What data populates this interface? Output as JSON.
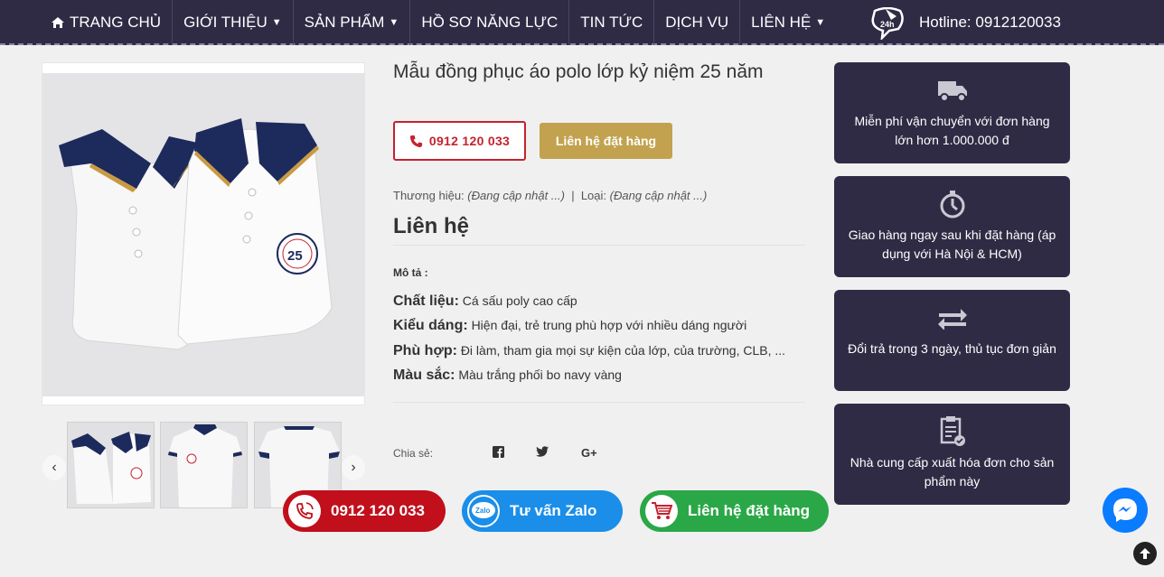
{
  "nav": {
    "items": [
      {
        "label": "TRANG CHỦ",
        "icon": "home-icon"
      },
      {
        "label": "GIỚI THIỆU",
        "caret": true
      },
      {
        "label": "SẢN PHẨM",
        "caret": true
      },
      {
        "label": "HỒ SƠ NĂNG LỰC"
      },
      {
        "label": "TIN TỨC"
      },
      {
        "label": "DỊCH VỤ"
      },
      {
        "label": "LIÊN HỆ",
        "caret": true
      }
    ],
    "hotline_badge": "24h",
    "hotline": "Hotline: 0912120033"
  },
  "product": {
    "title": "Mẫu đồng phục áo polo lớp kỷ niệm 25 năm",
    "phone_button": "0912 120 033",
    "order_button": "Liên hệ đặt hàng",
    "brand_label": "Thương hiệu:",
    "brand_value": "(Đang cập nhật ...)",
    "separator": "|",
    "type_label": "Loại:",
    "type_value": "(Đang cập nhật ...)",
    "price": "Liên hệ",
    "desc_label": "Mô tả :",
    "specs": [
      {
        "label": "Chất liệu:",
        "value": "Cá sấu poly cao cấp"
      },
      {
        "label": "Kiểu dáng:",
        "value": "Hiện đại, trẻ trung phù hợp với nhiều dáng người"
      },
      {
        "label": "Phù hợp:",
        "value": "Đi làm, tham gia mọi sự kiện của lớp, của trường, CLB, ..."
      },
      {
        "label": "Màu sắc:",
        "value": "Màu trắng phối bo navy vàng"
      }
    ],
    "share_label": "Chia sẻ:",
    "share_icons": [
      "f",
      "t",
      "G+"
    ],
    "logo_text": "25"
  },
  "services": [
    {
      "icon": "truck-icon",
      "text": "Miễn phí vận chuyển với đơn hàng lớn hơn 1.000.000 đ"
    },
    {
      "icon": "stopwatch-icon",
      "text": "Giao hàng ngay sau khi đặt hàng (áp dụng với Hà Nội & HCM)"
    },
    {
      "icon": "exchange-icon",
      "text": "Đổi trả trong 3 ngày, thủ tục đơn giản"
    },
    {
      "icon": "invoice-icon",
      "text": "Nhà cung cấp xuất hóa đơn cho sản phẩm này"
    }
  ],
  "floating": {
    "call": "0912 120 033",
    "zalo": "Tư vấn Zalo",
    "zalo_badge": "Zalo",
    "order": "Liên hệ đặt hàng"
  },
  "colors": {
    "nav_bg": "#302b45",
    "accent_red": "#c4222e",
    "accent_gold": "#c2a24f",
    "float_red": "#c10f1c",
    "float_blue": "#1a8ee8",
    "float_green": "#2aa747",
    "messenger_blue": "#0a7cff"
  }
}
